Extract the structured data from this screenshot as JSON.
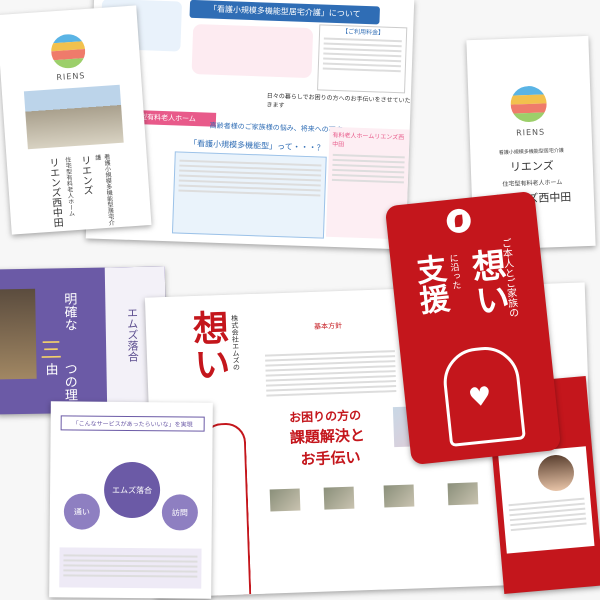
{
  "left_brochure": {
    "brand": "RIENS",
    "subtitle": "看護小規模多機能型居宅介護",
    "name_1": "リエンズ",
    "subtitle_2": "住宅型有料老人ホーム",
    "name_2": "リエンズ西中田"
  },
  "top_flyer": {
    "banner": "「看護小規模多機能型居宅介護」について",
    "section_1": "高齢者様のご家族様の悩み、将来への不安…",
    "section_2": "「看護小規模多機能型」って・・・？",
    "side_title": "【ご利用料金】",
    "band": "日々の暮らしでお困りの方へのお手伝いをさせていただきます",
    "sub_section": "住宅型有料老人ホーム",
    "right_box": "有料老人ホームリエンズ西中田"
  },
  "right_brochure": {
    "brand": "RIENS",
    "subtitle": "看護小規模多機能型居宅介護",
    "name_1": "リエンズ",
    "subtitle_2": "住宅型有料老人ホーム",
    "name_2": "リエンズ西中田"
  },
  "red_card": {
    "line_1": "ご本人とご家族の",
    "line_2": "想い",
    "line_3": "に沿った",
    "line_4": "支援"
  },
  "purple_flyer": {
    "line_1": "明確な",
    "line_2": "つの理由",
    "line_3": "エムズ落合",
    "number": "三"
  },
  "spread": {
    "title": "想い",
    "company": "株式会社エムズの",
    "section": "基本方針",
    "heading_1": "お困りの方の",
    "heading_2": "課題解決と",
    "heading_3": "お手伝い"
  },
  "bottom_flyer": {
    "headline": "「こんなサービスがあったらいいな」を実現",
    "center": "エムズ落合",
    "sub_1": "通い",
    "sub_2": "訪問"
  },
  "colors": {
    "red": "#c4161c",
    "purple": "#6b5aa6",
    "blue": "#2f6db5",
    "pink": "#e85a8a"
  }
}
